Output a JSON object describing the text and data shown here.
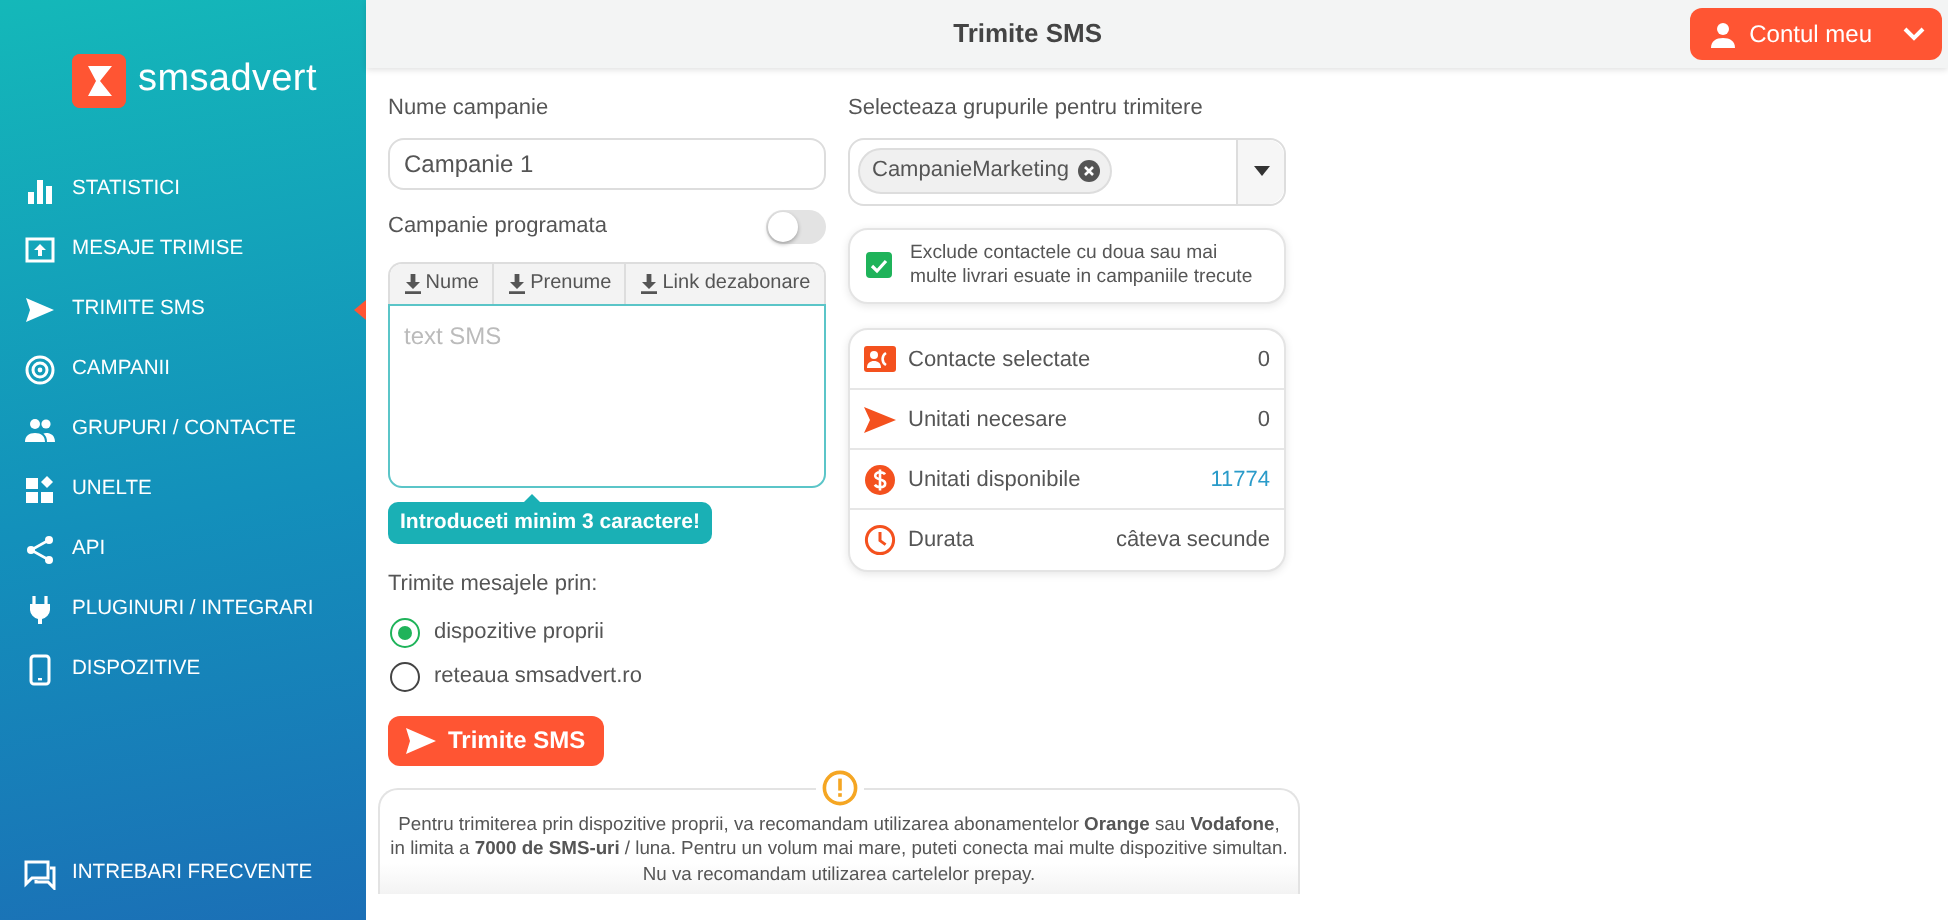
{
  "sidebar": {
    "logo": "smsadvert",
    "items": [
      {
        "label": "STATISTICI",
        "selected": false
      },
      {
        "label": "MESAJE TRIMISE",
        "selected": false
      },
      {
        "label": "TRIMITE SMS",
        "selected": true
      },
      {
        "label": "CAMPANII",
        "selected": false
      },
      {
        "label": "GRUPURI / CONTACTE",
        "selected": false
      },
      {
        "label": "UNELTE",
        "selected": false
      },
      {
        "label": "API",
        "selected": false
      },
      {
        "label": "PLUGINURI / INTEGRARI",
        "selected": false
      },
      {
        "label": "DISPOZITIVE",
        "selected": false
      }
    ],
    "footer_item": {
      "label": "INTREBARI FRECVENTE"
    }
  },
  "header": {
    "title": "Trimite SMS",
    "account_button": "Contul meu"
  },
  "form": {
    "campaign_name": {
      "label": "Nume campanie",
      "value": "Campanie 1"
    },
    "scheduled": {
      "label": "Campanie programata",
      "on": false
    },
    "insert_buttons": [
      "Nume",
      "Prenume",
      "Link dezabonare"
    ],
    "message": {
      "placeholder": "text SMS"
    },
    "hint": "Introduceti minim 3 caractere!",
    "send_via": {
      "label": "Trimite mesajele prin:",
      "options": [
        {
          "label": "dispozitive proprii",
          "selected": true
        },
        {
          "label": "reteaua smsadvert.ro",
          "selected": false
        }
      ]
    },
    "send_button": "Trimite SMS"
  },
  "groups": {
    "label": "Selecteaza grupurile pentru trimitere",
    "tags": [
      "CampanieMarketing"
    ],
    "exclude": {
      "label": "Exclude contactele cu doua sau mai multe livrari esuate in campaniile trecute",
      "checked": true
    }
  },
  "summary": [
    {
      "kind": "contacts",
      "label": "Contacte selectate",
      "value": "0"
    },
    {
      "kind": "units",
      "label": "Unitati necesare",
      "value": "0"
    },
    {
      "kind": "balance",
      "label": "Unitati disponibile",
      "value": "11774"
    },
    {
      "kind": "duration",
      "label": "Durata",
      "value": "câteva secunde"
    }
  ],
  "notice": "Pentru trimiterea prin dispozitive proprii, va recomandam utilizarea abonamentelor **Orange** sau **Vodafone**, in limita a **7000 de SMS-uri** / luna. Pentru un volum mai mare, puteti conecta mai multe dispozitive simultan. Nu va recomandam utilizarea cartelelor prepay."
}
